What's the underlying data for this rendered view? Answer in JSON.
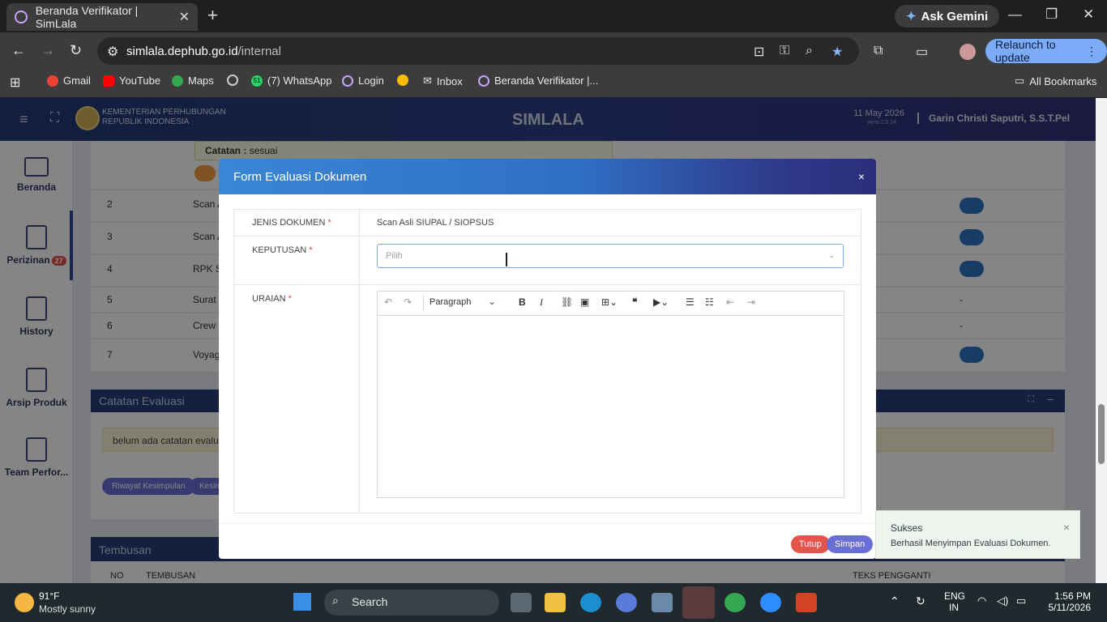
{
  "browser": {
    "tab_title": "Beranda Verifikator | SimLala",
    "gemini": "Ask Gemini",
    "url_domain": "simlala.dephub.go.id",
    "url_path": "/internal",
    "relaunch": "Relaunch to update",
    "bookmarks": [
      "Gmail",
      "YouTube",
      "Maps",
      "(7) WhatsApp",
      "Login",
      "Inbox",
      "Beranda Verifikator |..."
    ],
    "whatsapp_badge": "51",
    "all_bookmarks": "All Bookmarks"
  },
  "app": {
    "ministry_line1": "KEMENTERIAN PERHUBUNGAN",
    "ministry_line2": "REPUBLIK INDONESIA",
    "brand": "SIMLALA",
    "date": "11 May 2026",
    "version": "versi 2.0.24",
    "user": "Garin Christi Saputri, S.S.T.Pel"
  },
  "sidebar": {
    "items": [
      {
        "label": "Beranda"
      },
      {
        "label": "Perizinan",
        "badge": "27"
      },
      {
        "label": "History"
      },
      {
        "label": "Arsip Produk"
      },
      {
        "label": "Team Perfor..."
      }
    ]
  },
  "background": {
    "catatan_label": "Catatan :",
    "catatan_value": "sesuai",
    "rows": [
      {
        "no": "2",
        "doc": "Scan A",
        "action": "edit"
      },
      {
        "no": "3",
        "doc": "Scan A",
        "action": "edit"
      },
      {
        "no": "4",
        "doc": "RPK Se",
        "action": "edit"
      },
      {
        "no": "5",
        "doc": "Surat D",
        "action": "-"
      },
      {
        "no": "6",
        "doc": "Crew li",
        "action": "-"
      },
      {
        "no": "7",
        "doc": "Voyage",
        "action": "edit"
      }
    ],
    "catatan_evaluasi_title": "Catatan Evaluasi",
    "empty_note": "belum ada catatan evaluasi",
    "btn_riwayat": "Riwayat Kesimpulan",
    "btn_kesim": "Kesim",
    "tembusan_title": "Tembusan",
    "col_no": "NO",
    "col_tembusan": "TEMBUSAN",
    "col_teks": "TEKS PENGGANTI"
  },
  "modal": {
    "title": "Form Evaluasi Dokumen",
    "close": "×",
    "jenis_label": "JENIS DOKUMEN",
    "jenis_value": "Scan Asli SIUPAL / SIOPSUS",
    "keputusan_label": "KEPUTUSAN",
    "keputusan_placeholder": "Pilih",
    "uraian_label": "URAIAN",
    "required_mark": "*",
    "paragraph": "Paragraph",
    "btn_tutup": "Tutup",
    "btn_simpan": "Simpan"
  },
  "toast": {
    "title": "Sukses",
    "message": "Berhasil Menyimpan Evaluasi Dokumen.",
    "close": "×"
  },
  "taskbar": {
    "temp": "91°F",
    "weather": "Mostly sunny",
    "search": "Search",
    "lang1": "ENG",
    "lang2": "IN",
    "time": "1:56 PM",
    "date": "5/11/2026"
  }
}
